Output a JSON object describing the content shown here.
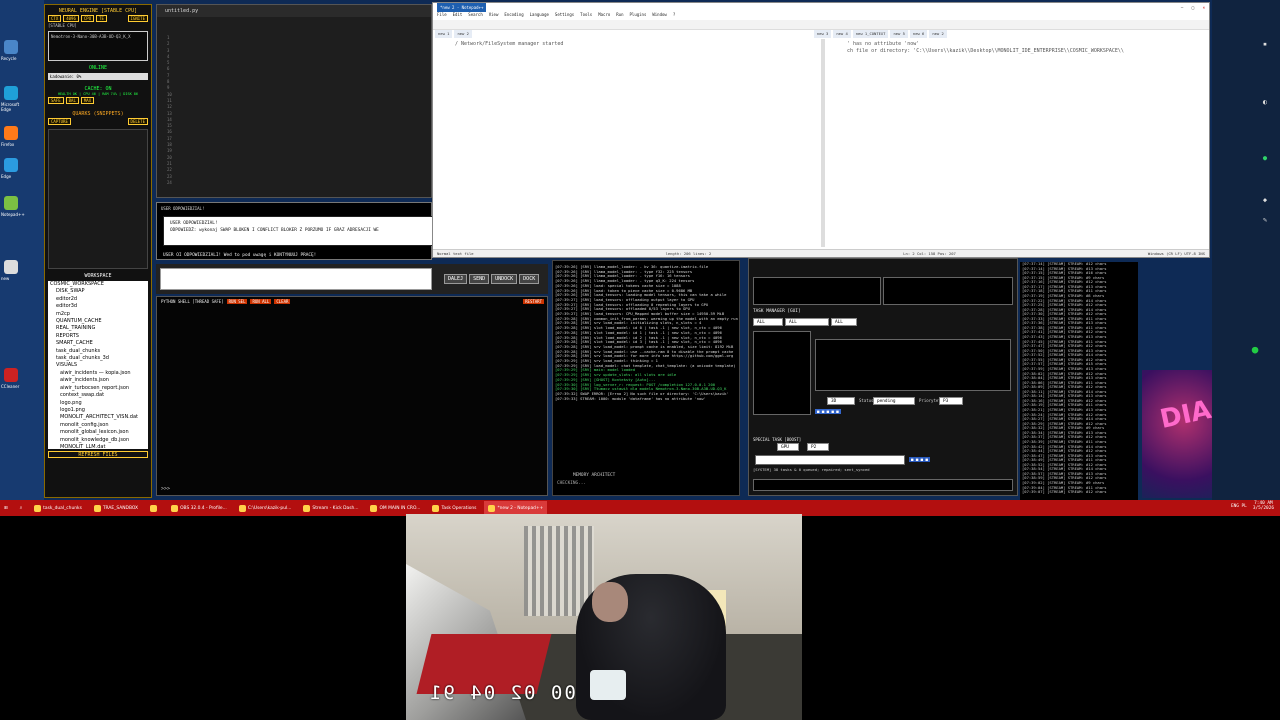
{
  "desktop": {
    "icons": [
      {
        "label": "Recycle",
        "color": "#4a86c8"
      },
      {
        "label": "Microsoft Edge",
        "color": "#1fa0d8"
      },
      {
        "label": "Firefox",
        "color": "#ff7a1a"
      },
      {
        "label": "Edge",
        "color": "#2b9be0"
      },
      {
        "label": "Notepad++",
        "color": "#7bc043"
      },
      {
        "label": "new",
        "color": "#dddddd"
      },
      {
        "label": "CCleaner",
        "color": "#cc2222"
      }
    ]
  },
  "neural_panel": {
    "title": "NEURAL ENGINE [STABLE CPU]",
    "chips": [
      "CTX",
      "4096",
      "CPU",
      "TE"
    ],
    "ignite": "IGNITE",
    "stable": "[STABLE CPU]",
    "model": "Nemotron-3-Nano-30B-A3B-UD-Q3_K_X",
    "status": "ONLINE",
    "loading": "Ładowanie: 0%",
    "cache": "CACHE: ON",
    "health": "HEALTH OK | CPU 46 | RAM 74% | DISK 86",
    "modes": [
      "SAFE",
      "BAL",
      "MAX"
    ],
    "quarks": "QUARKS (SNIPPETS)",
    "capture": "CAPTURE",
    "delete": "DELETE",
    "workspace": "WORKSPACE",
    "tree": [
      "COSMIC_WORKSPACE",
      "DISK_SWAP",
      "editor2d",
      "editor3d",
      "m2cp",
      "QUANTUM_CACHE",
      "REAL_TRAINING",
      "REPORTS",
      "SMART_CACHE",
      "task_dual_chunks",
      "task_dual_chunks_3d",
      "VISUALS",
      "aiwir_incidents — kopia.json",
      "aiwir_incidents.json",
      "aiwir_turbocsen_report.json",
      "context_swap.dat",
      "logo.png",
      "logo1.png",
      "MONOLIT_ARCHITECT_VISN.dat",
      "monolit_config.json",
      "monolit_global_lexicon.json",
      "monolit_knowledge_db.json",
      "MONOLIT_LLM.dat"
    ],
    "refresh": "REFRESH FILES"
  },
  "editor": {
    "title": "untitled.py",
    "line_count": 24
  },
  "assistant": {
    "header": "USER ODPOWIEDZIAL!",
    "line1": "USER ODPOWIEDZIAL!",
    "line2": "ODPOWIEDŹ: wykonaj SWAP BLOKEN I CONFLICT BLOKER Z PORZUMO IF GRAZ ADRESACJI WE",
    "footer": "USER OI ODPOWIEDZIALI! Wed to pod uwagę i KONTYNUUJ PRACĘ!"
  },
  "input_row": {
    "buttons": [
      "DALEJ",
      "SEND",
      "UNDOCK",
      "DOCK"
    ]
  },
  "pyshell": {
    "title": "PYTHON SHELL [THREAD SAFE]",
    "chips": [
      "RUN SEL",
      "RUN ALL",
      "CLEAR"
    ],
    "prompt": ">>>",
    "restart": "RESTART"
  },
  "server_log": {
    "lines": [
      {
        "t": "[07:39:26] [SRV] llama_model_loader: - kv  36:  quantize.imatrix.file",
        "g": false
      },
      {
        "t": "[07:39:26] [SRV] llama_model_loader: - type  f32:  225 tensors",
        "g": false
      },
      {
        "t": "[07:39:26] [SRV] llama_model_loader: - type  f16:   16 tensors",
        "g": false
      },
      {
        "t": "[07:39:26] [SRV] llama_model_loader: - type q3_K:  224 tensors",
        "g": false
      },
      {
        "t": "[07:39:26] [SRV] load: special tokens cache size = 1088",
        "g": false
      },
      {
        "t": "[07:39:26] [SRV] load: token to piece cache size = 0.9686 MB",
        "g": false
      },
      {
        "t": "[07:39:26] [SRV] load_tensors: loading model tensors, this can take a while",
        "g": false
      },
      {
        "t": "[07:39:27] [SRV] load_tensors: offloading output layer to GPU",
        "g": false
      },
      {
        "t": "[07:39:27] [SRV] load_tensors: offloading 0 repeating layers to GPU",
        "g": false
      },
      {
        "t": "[07:39:27] [SRV] load_tensors: offloaded 0/53 layers to GPU",
        "g": false
      },
      {
        "t": "[07:39:27] [SRV] load_tensors:   CPU_Mapped model buffer size = 14950.59 MiB",
        "g": false
      },
      {
        "t": "[07:39:28] [SRV] common_init_from_params: warming up the model with an empty run",
        "g": false
      },
      {
        "t": "[07:39:28] [SRV] srv  load_model: initializing slots, n_slots = 4",
        "g": false
      },
      {
        "t": "[07:39:28] [SRV] slot  load_model: id 0 | task -1 | new slot, n_ctx = 4096",
        "g": false
      },
      {
        "t": "[07:39:28] [SRV] slot  load_model: id 1 | task -1 | new slot, n_ctx = 4096",
        "g": false
      },
      {
        "t": "[07:39:28] [SRV] slot  load_model: id 2 | task -1 | new slot, n_ctx = 4096",
        "g": false
      },
      {
        "t": "[07:39:28] [SRV] slot  load_model: id 3 | task -1 | new slot, n_ctx = 4096",
        "g": false
      },
      {
        "t": "[07:39:28] [SRV] srv  load_model: prompt cache is enabled, size limit: 8192 MiB",
        "g": false
      },
      {
        "t": "[07:39:28] [SRV] srv  load_model: use --cache-ram 0 to disable the prompt cache",
        "g": false
      },
      {
        "t": "[07:39:28] [SRV] srv  load_model: for more info see https://github.com/ggml-org",
        "g": false
      },
      {
        "t": "[07:39:29] [SRV] srv  load_model: thinking = 1",
        "g": false
      },
      {
        "t": "[07:39:29] [SRV] load_model: chat template, chat_template: (a unicode template)",
        "g": false
      },
      {
        "t": "[07:39:29] [SRV] main: model loaded",
        "g": true
      },
      {
        "t": "[07:39:29] [SRV] srv  update_slots: all slots are idle",
        "g": true
      },
      {
        "t": "[07:39:29] [SRV] [GHOST] Konteksty [Auto]...",
        "g": true
      },
      {
        "t": "[07:39:30] [SRV] log_server_r: request: POST /completion 127.0.0.1 200",
        "g": true
      },
      {
        "t": "[07:39:30] [SRV] Tłumacz ustawił dla modelu Nemotron-3-Nano-30B-A3B-UD-Q3_K",
        "g": true
      },
      {
        "t": "[07:39:32] SWAP ERROR: [Errno 2] No such file or directory: 'C:\\Users\\kazik'",
        "g": false
      },
      {
        "t": "[07:39:33] STREAM: 1000: module 'dataframe' has no attribute 'now'",
        "g": false
      }
    ],
    "memory": "MEMORY ARCHITECT",
    "checking": "CHECKING..."
  },
  "task_manager": {
    "title": "TASK MANAGER [GUI]",
    "filters": [
      "ALL",
      "ALL",
      "ALL"
    ],
    "status_label": "Status",
    "status_value": "pending",
    "priority_label": "Priorytet",
    "priority_value": "P3",
    "type_value": "3D",
    "special_label": "SPECIAL TASK [BOOST]",
    "model_chip": "GPU",
    "p_chip": "P2",
    "footer": "[SYSTEM] 38 tasks & 0 queued; repaired; sent_synced"
  },
  "stream_log": {
    "lines": [
      "[07:37:14] [STREAM] STREAM: #12 chars",
      "[07:37:14] [STREAM] STREAM: #13 chars",
      "[07:37:15] [STREAM] STREAM: #16 chars",
      "[07:37:15] [STREAM] STREAM: #9 chars",
      "[07:37:16] [STREAM] STREAM: #12 chars",
      "[07:37:17] [STREAM] STREAM: #13 chars",
      "[07:37:18] [STREAM] STREAM: #11 chars",
      "[07:37:19] [STREAM] STREAM: #8 chars",
      "[07:37:22] [STREAM] STREAM: #14 chars",
      "[07:37:25] [STREAM] STREAM: #12 chars",
      "[07:37:28] [STREAM] STREAM: #14 chars",
      "[07:37:30] [STREAM] STREAM: #12 chars",
      "[07:37:33] [STREAM] STREAM: #11 chars",
      "[07:37:36] [STREAM] STREAM: #13 chars",
      "[07:37:38] [STREAM] STREAM: #11 chars",
      "[07:37:41] [STREAM] STREAM: #12 chars",
      "[07:37:43] [STREAM] STREAM: #13 chars",
      "[07:37:45] [STREAM] STREAM: #11 chars",
      "[07:37:47] [STREAM] STREAM: #12 chars",
      "[07:37:50] [STREAM] STREAM: #13 chars",
      "[07:37:52] [STREAM] STREAM: #14 chars",
      "[07:37:55] [STREAM] STREAM: #12 chars",
      "[07:37:57] [STREAM] STREAM: #15 chars",
      "[07:37:59] [STREAM] STREAM: #13 chars",
      "[07:38:02] [STREAM] STREAM: #12 chars",
      "[07:38:04] [STREAM] STREAM: #13 chars",
      "[07:38:06] [STREAM] STREAM: #11 chars",
      "[07:38:09] [STREAM] STREAM: #12 chars",
      "[07:38:11] [STREAM] STREAM: #14 chars",
      "[07:38:14] [STREAM] STREAM: #13 chars",
      "[07:38:16] [STREAM] STREAM: #12 chars",
      "[07:38:19] [STREAM] STREAM: #11 chars",
      "[07:38:21] [STREAM] STREAM: #13 chars",
      "[07:38:24] [STREAM] STREAM: #12 chars",
      "[07:38:27] [STREAM] STREAM: #14 chars",
      "[07:38:29] [STREAM] STREAM: #12 chars",
      "[07:38:32] [STREAM] STREAM: #9 chars",
      "[07:38:34] [STREAM] STREAM: #13 chars",
      "[07:38:37] [STREAM] STREAM: #12 chars",
      "[07:38:39] [STREAM] STREAM: #11 chars",
      "[07:38:42] [STREAM] STREAM: #14 chars",
      "[07:38:44] [STREAM] STREAM: #12 chars",
      "[07:38:47] [STREAM] STREAM: #13 chars",
      "[07:38:49] [STREAM] STREAM: #11 chars",
      "[07:38:52] [STREAM] STREAM: #12 chars",
      "[07:38:54] [STREAM] STREAM: #14 chars",
      "[07:38:57] [STREAM] STREAM: #13 chars",
      "[07:38:59] [STREAM] STREAM: #12 chars",
      "[07:39:02] [STREAM] STREAM: #9 chars",
      "[07:39:04] [STREAM] STREAM: #11 chars",
      "[07:39:07] [STREAM] STREAM: #12 chars"
    ]
  },
  "wallpaper": {
    "text": "DIA"
  },
  "notepadpp": {
    "title": "*new 2 - Notepad++",
    "menu": [
      "File",
      "Edit",
      "Search",
      "View",
      "Encoding",
      "Language",
      "Settings",
      "Tools",
      "Macro",
      "Run",
      "Plugins",
      "Window",
      "?"
    ],
    "tabs_left": [
      "new 1",
      "new 2"
    ],
    "tabs_right": [
      "new 3",
      "new 4",
      "new 1_CONTEXT",
      "new 5",
      "new 6",
      "new 2"
    ],
    "left_text": "/ Network/FileSystem manager started",
    "right_line1": "' has no attribute 'now'",
    "right_line2": "ch file or directory: 'C:\\\\Users\\\\kazik\\\\Desktop\\\\MONOLIT_IDE_ENTERPRISE\\\\COSMIC_WORKSPACE\\\\",
    "status_left": "Normal text file",
    "status_mid": "length: 206   lines: 2",
    "status_pos": "Ln: 2   Col: 158   Pos: 207",
    "status_right": "Windows (CR LF)   UTF-8   INS"
  },
  "taskbar": {
    "items": [
      {
        "label": "task_dual_chunks",
        "active": false
      },
      {
        "label": "TRAE_SANDBOX",
        "active": false
      },
      {
        "label": "",
        "active": false
      },
      {
        "label": "OBS 32.0.4 - Profile...",
        "active": false
      },
      {
        "label": "C:\\Users\\kazik-pul...",
        "active": false
      },
      {
        "label": "Stream - Kick Dash...",
        "active": false
      },
      {
        "label": "OM MAIN IN CRO...",
        "active": false
      },
      {
        "label": "Task Operations",
        "active": false
      },
      {
        "label": "*new 2 - Notepad++",
        "active": true
      }
    ],
    "lang": "ENG PL",
    "time": "7:40 AM",
    "date": "3/5/2026"
  },
  "webcam": {
    "timestamp": "00 02 04 91"
  }
}
